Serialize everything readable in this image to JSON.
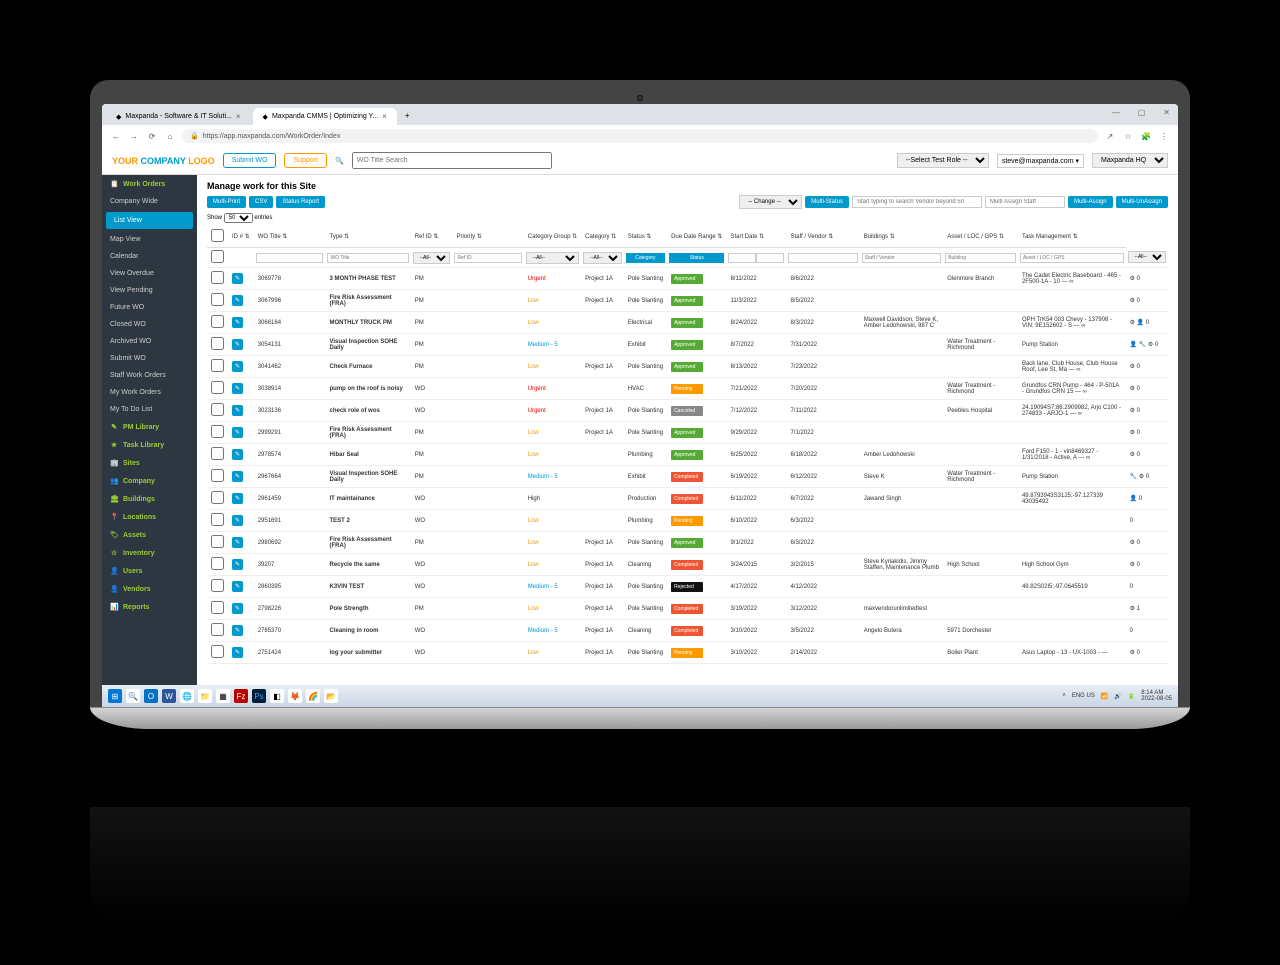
{
  "browser": {
    "tabs": [
      {
        "title": "Maxpanda - Software & IT Soluti..."
      },
      {
        "title": "Maxpanda CMMS | Optimizing Y..."
      }
    ],
    "url": "https://app.maxpanda.com/WorkOrder/Index",
    "windowButtons": {
      "min": "—",
      "max": "▢",
      "close": "✕"
    }
  },
  "appHeader": {
    "logoPrefix": "YOUR ",
    "logoMid": "COMPANY ",
    "logoSuffix": "LOGO",
    "submitBtn": "Submit WO",
    "supportBtn": "Support",
    "searchPlaceholder": "WO Title Search",
    "roleSelect": "--Select Test Role --",
    "userEmail": "steve@maxpanda.com",
    "siteSelect": "Maxpanda HQ"
  },
  "sidebar": {
    "items": [
      {
        "label": "Work Orders",
        "icon": "📋",
        "head": true
      },
      {
        "label": "Company Wide"
      },
      {
        "label": "List View",
        "active": true
      },
      {
        "label": "Map View"
      },
      {
        "label": "Calendar"
      },
      {
        "label": "View Overdue"
      },
      {
        "label": "View Pending"
      },
      {
        "label": "Future WO"
      },
      {
        "label": "Closed WO"
      },
      {
        "label": "Archived WO"
      },
      {
        "label": "Submit WO"
      },
      {
        "label": "Staff Work Orders"
      },
      {
        "label": "My Work Orders"
      },
      {
        "label": "My To Do List"
      },
      {
        "label": "PM Library",
        "icon": "✎",
        "head": true
      },
      {
        "label": "Task Library",
        "icon": "★",
        "head": true
      },
      {
        "label": "Sites",
        "icon": "🏢",
        "head": true
      },
      {
        "label": "Company",
        "icon": "👥",
        "head": true
      },
      {
        "label": "Buildings",
        "icon": "🏛",
        "head": true
      },
      {
        "label": "Locations",
        "icon": "📍",
        "head": true
      },
      {
        "label": "Assets",
        "icon": "🏷",
        "head": true
      },
      {
        "label": "Inventory",
        "icon": "☆",
        "head": true
      },
      {
        "label": "Users",
        "icon": "👤",
        "head": true
      },
      {
        "label": "Vendors",
        "icon": "👤",
        "head": true
      },
      {
        "label": "Reports",
        "icon": "📊",
        "head": true
      }
    ]
  },
  "page": {
    "title": "Manage work for this Site",
    "multiPrint": "Multi-Print",
    "csv": "CSV",
    "statusReport": "Status Report",
    "changeSelect": "-- Change --",
    "multiStatus": "Multi-Status",
    "vendorSearchPlaceholder": "Start typing to search Vendor beyond 50",
    "staffSearchPlaceholder": "Multi Assign Staff",
    "multiAssign": "Multi-Assign",
    "multiUnassign": "Multi-UnAssign",
    "showLabel": "Show",
    "showCount": "50",
    "entriesLabel": "entries"
  },
  "columns": [
    "",
    "ID #",
    "WO Title",
    "Type",
    "Ref ID",
    "Priority",
    "Category Group",
    "Category",
    "Status",
    "Due Date Range",
    "Start Date",
    "Staff / Vendor",
    "Buildings",
    "Asset / LOC / GPS",
    "Task Management"
  ],
  "filters": {
    "woTitle": "WO Title",
    "typeAll": "--All--",
    "refId": "Ref ID",
    "priAll": "--All--",
    "catAll": "--All--",
    "categoryBtn": "Category",
    "statusBtn": "Status",
    "staffPlaceholder": "Staff / Vendor",
    "buildingPlaceholder": "Building",
    "assetPlaceholder": "Asset / LOC / GPS",
    "taskAll": "--All--"
  },
  "rows": [
    {
      "id": "3069778",
      "title": "3 MONTH PHASE TEST",
      "type": "PM",
      "ref": "",
      "priority": "Urgent",
      "priClass": "pr-urgent",
      "group": "Project 1A",
      "category": "Pole Slanting",
      "status": "Approved",
      "statusClass": "st-approved",
      "due": "8/11/2022",
      "start": "8/6/2022",
      "staff": "",
      "building": "Glenmore Branch",
      "asset": "The Cadet Electric Baseboard - 465 - 2F500-1A - 10 — ∞",
      "task": "⚙ 0"
    },
    {
      "id": "3067996",
      "title": "Fire Risk Assessment (FRA)",
      "type": "PM",
      "ref": "",
      "priority": "Low",
      "priClass": "pr-low",
      "group": "Project 1A",
      "category": "Pole Slanting",
      "status": "Approved",
      "statusClass": "st-approved",
      "due": "11/3/2022",
      "start": "8/5/2022",
      "staff": "",
      "building": "",
      "asset": "",
      "task": "⚙ 0"
    },
    {
      "id": "3066184",
      "title": "MONTHLY TRUCK PM",
      "type": "PM",
      "ref": "",
      "priority": "Low",
      "priClass": "pr-low",
      "group": "",
      "category": "Electrical",
      "status": "Approved",
      "statusClass": "st-approved",
      "due": "8/24/2022",
      "start": "8/3/2022",
      "staff": "Maxwell Davidson, Steve K, Amber Ledohowski, 987 C",
      "building": "",
      "asset": "OPH TrK54 003 Chevy - 137908 - VIN: 9E152602 - S — ∞",
      "task": "⚙ 👤 0"
    },
    {
      "id": "3054131",
      "title": "Visual Inspection SOHE Daily",
      "type": "PM",
      "ref": "",
      "priority": "Medium - 5",
      "priClass": "pr-medium",
      "group": "",
      "category": "Exhibit",
      "status": "Approved",
      "statusClass": "st-approved",
      "due": "8/7/2022",
      "start": "7/31/2022",
      "staff": "",
      "building": "Water Treatment - Richmond",
      "asset": "Pump Station",
      "task": "👤 🔧 ⚙ 0"
    },
    {
      "id": "3041462",
      "title": "Check Furnace",
      "type": "PM",
      "ref": "",
      "priority": "Low",
      "priClass": "pr-low",
      "group": "Project 1A",
      "category": "Pole Slanting",
      "status": "Approved",
      "statusClass": "st-approved",
      "due": "8/13/2022",
      "start": "7/23/2022",
      "staff": "",
      "building": "",
      "asset": "Back lane, Club House, Club House Roof, Lee St, Ma — ∞",
      "task": "⚙ 0"
    },
    {
      "id": "3038914",
      "title": "pump on the roof is noisy",
      "type": "WO",
      "ref": "",
      "priority": "Urgent",
      "priClass": "pr-urgent",
      "group": "",
      "category": "HVAC",
      "status": "Pending",
      "statusClass": "st-pending",
      "due": "7/21/2022",
      "start": "7/20/2022",
      "staff": "",
      "building": "Water Treatment - Richmond",
      "asset": "Grundfos CRN Pump - 464 - P-501A - Grundfos CRN 15 — ∞",
      "task": "⚙ 0"
    },
    {
      "id": "3023136",
      "title": "check role of wos",
      "type": "WO",
      "ref": "",
      "priority": "Urgent",
      "priClass": "pr-urgent",
      "group": "Project 1A",
      "category": "Pole Slanting",
      "status": "Canceled",
      "statusClass": "st-canceled",
      "due": "7/12/2022",
      "start": "7/11/2022",
      "staff": "",
      "building": "Peebles Hospital",
      "asset": "24.19094S7;86.2909982, Arjo C100 - 274833 - ARJO-1 — ∞",
      "task": "⚙ 0"
    },
    {
      "id": "2999291",
      "title": "Fire Risk Assessment (FRA)",
      "type": "PM",
      "ref": "",
      "priority": "Low",
      "priClass": "pr-low",
      "group": "Project 1A",
      "category": "Pole Slanting",
      "status": "Approved",
      "statusClass": "st-approved",
      "due": "9/29/2022",
      "start": "7/1/2022",
      "staff": "",
      "building": "",
      "asset": "",
      "task": "⚙ 0"
    },
    {
      "id": "2978574",
      "title": "Hibar Seal",
      "type": "PM",
      "ref": "",
      "priority": "Low",
      "priClass": "pr-low",
      "group": "",
      "category": "Plumbing",
      "status": "Approved",
      "statusClass": "st-approved",
      "due": "6/25/2022",
      "start": "6/18/2022",
      "staff": "Amber Ledohowski",
      "building": "",
      "asset": "Ford F150 - 1 - vin8469327 - 1/31/2018 - Active, A — ∞",
      "task": "⚙ 0"
    },
    {
      "id": "2967664",
      "title": "Visual Inspection SOHE Daily",
      "type": "PM",
      "ref": "",
      "priority": "Medium - 5",
      "priClass": "pr-medium",
      "group": "",
      "category": "Exhibit",
      "status": "Completed",
      "statusClass": "st-completed",
      "due": "6/19/2022",
      "start": "6/12/2022",
      "staff": "Steve K",
      "building": "Water Treatment - Richmond",
      "asset": "Pump Station",
      "task": "🔧 ⚙ 0"
    },
    {
      "id": "2961459",
      "title": "IT maintainance",
      "type": "WO",
      "ref": "",
      "priority": "High",
      "priClass": "",
      "group": "",
      "category": "Production",
      "status": "Completed",
      "statusClass": "st-completed",
      "due": "6/11/2022",
      "start": "6/7/2022",
      "staff": "Jawand Singh",
      "building": "",
      "asset": "49.8793943S3125;-97.127339 43035492",
      "task": "👤 0"
    },
    {
      "id": "2951691",
      "title": "TEST 2",
      "type": "WO",
      "ref": "",
      "priority": "Low",
      "priClass": "pr-low",
      "group": "",
      "category": "Plumbing",
      "status": "Pending",
      "statusClass": "st-pending",
      "due": "6/10/2022",
      "start": "6/3/2022",
      "staff": "",
      "building": "",
      "asset": "",
      "task": "0"
    },
    {
      "id": "2980692",
      "title": "Fire Risk Assessment (FRA)",
      "type": "PM",
      "ref": "",
      "priority": "Low",
      "priClass": "pr-low",
      "group": "Project 1A",
      "category": "Pole Slanting",
      "status": "Approved",
      "statusClass": "st-approved",
      "due": "9/1/2022",
      "start": "6/3/2022",
      "staff": "",
      "building": "",
      "asset": "",
      "task": "⚙ 0"
    },
    {
      "id": "39207",
      "title": "Recycle the same",
      "type": "WO",
      "ref": "",
      "priority": "Low",
      "priClass": "pr-low",
      "group": "Project 1A",
      "category": "Cleaning",
      "status": "Completed",
      "statusClass": "st-completed",
      "due": "3/24/2015",
      "start": "3/2/2015",
      "staff": "Steve Kyriakidis, Jimmy Staffen, Maintenance Plumb",
      "building": "High School",
      "asset": "High School Gym",
      "task": "⚙ 0"
    },
    {
      "id": "2860395",
      "title": "K3VIN TEST",
      "type": "WO",
      "ref": "",
      "priority": "Medium - 5",
      "priClass": "pr-medium",
      "group": "Project 1A",
      "category": "Pole Slanting",
      "status": "Rejected",
      "statusClass": "st-rejected",
      "due": "4/17/2022",
      "start": "4/12/2022",
      "staff": "",
      "building": "",
      "asset": "49.82S02l5;-97.0645519",
      "task": "0"
    },
    {
      "id": "2798226",
      "title": "Pole Strength",
      "type": "PM",
      "ref": "",
      "priority": "Low",
      "priClass": "pr-low",
      "group": "Project 1A",
      "category": "Pole Slanting",
      "status": "Completed",
      "statusClass": "st-completed",
      "due": "3/19/2022",
      "start": "3/12/2022",
      "staff": "maxvendorunlimitedtest",
      "building": "",
      "asset": "",
      "task": "⚙ 1"
    },
    {
      "id": "2785370",
      "title": "Cleaning in room",
      "type": "WO",
      "ref": "",
      "priority": "Medium - 5",
      "priClass": "pr-medium",
      "group": "Project 1A",
      "category": "Cleaning",
      "status": "Completed",
      "statusClass": "st-completed",
      "due": "3/10/2022",
      "start": "3/5/2022",
      "staff": "Angelo Butera",
      "building": "5971 Dorchester",
      "asset": "",
      "task": "0"
    },
    {
      "id": "2751424",
      "title": "log your submitter",
      "type": "WO",
      "ref": "",
      "priority": "Low",
      "priClass": "pr-low",
      "group": "Project 1A",
      "category": "Pole Slanting",
      "status": "Pending",
      "statusClass": "st-pending",
      "due": "3/10/2022",
      "start": "2/14/2022",
      "staff": "",
      "building": "Boiler Plant",
      "asset": "Asus Laptop - 13 - UX-1003 - —",
      "task": "⚙ 0"
    }
  ],
  "taskbar": {
    "lang": "ENG US",
    "time": "8:14 AM",
    "date": "2022-08-05"
  }
}
